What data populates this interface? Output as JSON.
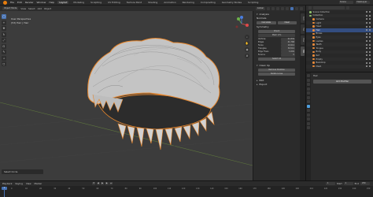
{
  "app": {
    "menus": [
      "File",
      "Edit",
      "Render",
      "Window",
      "Help"
    ],
    "workspaces": [
      "Layout",
      "Modeling",
      "Sculpting",
      "UV Editing",
      "Texture Paint",
      "Shading",
      "Animation",
      "Rendering",
      "Compositing",
      "Geometry Nodes",
      "Scripting"
    ],
    "active_workspace": "Layout",
    "scene_label": "Scene",
    "view_layer_label": "ViewLayer"
  },
  "viewport": {
    "mode_label": "Object Mode",
    "header_menus": [
      "View",
      "Select",
      "Add",
      "Object"
    ],
    "transform_label": "Global",
    "info_line1": "User Perspective",
    "info_line2": "(53) Hair | Hair",
    "operator_panel_label": "Select Circle"
  },
  "npanel": {
    "analysis_header": "Analysis",
    "normals_header": "Normals",
    "normals_btn1": "Calculate",
    "normals_btn2": "Clear",
    "symmetry_header": "Symmetry",
    "symmetry_btn": "Check",
    "symmetry_sub": "Mesh Info",
    "stats": [
      {
        "label": "Vertices",
        "value": "21,834"
      },
      {
        "label": "Edges",
        "value": "41,768"
      },
      {
        "label": "Faces",
        "value": "19,914"
      },
      {
        "label": "Triangles",
        "value": "39,512"
      },
      {
        "label": "Edge Flows",
        "value": "1,602"
      },
      {
        "label": "N-Gons",
        "value": "0"
      }
    ],
    "fill_btn": "Select All",
    "clean_header": "Clean Up",
    "clean_btn1": "Remove Doubles",
    "clean_btn2": "Delete Loose",
    "edit_header": "Edit",
    "export_header": "Export",
    "tabs": [
      "Item",
      "Tool",
      "View",
      "Edit"
    ]
  },
  "outliner": {
    "rows": [
      {
        "label": "Scene Collection",
        "selected": false,
        "type": "g"
      },
      {
        "label": "Collection",
        "selected": false,
        "type": "g"
      },
      {
        "label": "Camera",
        "selected": false,
        "type": "o"
      },
      {
        "label": "Light",
        "selected": false,
        "type": "o"
      },
      {
        "label": "Head",
        "selected": false,
        "type": "o"
      },
      {
        "label": "Hair",
        "selected": true,
        "type": "o"
      },
      {
        "label": "Brows",
        "selected": false,
        "type": "o"
      },
      {
        "label": "Eyes",
        "selected": false,
        "type": "o"
      },
      {
        "label": "Lashes",
        "selected": false,
        "type": "o"
      },
      {
        "label": "Teeth",
        "selected": false,
        "type": "o"
      },
      {
        "label": "Tongue",
        "selected": false,
        "type": "o"
      },
      {
        "label": "Body",
        "selected": false,
        "type": "o"
      },
      {
        "label": "Ref",
        "selected": false,
        "type": "o"
      },
      {
        "label": "Empty",
        "selected": false,
        "type": "o"
      },
      {
        "label": "Backdrop",
        "selected": false,
        "type": "o"
      },
      {
        "label": "Mesh",
        "selected": false,
        "type": "o"
      }
    ]
  },
  "properties": {
    "object_name": "Hair",
    "add_modifier_label": "Add Modifier"
  },
  "timeline": {
    "menus": [
      "Playback",
      "Keying",
      "View",
      "Marker"
    ],
    "current_frame": "1",
    "start_label": "Start",
    "start_value": "1",
    "end_label": "End",
    "end_value": "250",
    "ticks": [
      "0",
      "10",
      "20",
      "30",
      "40",
      "50",
      "60",
      "70",
      "80",
      "90",
      "100",
      "110",
      "120",
      "130",
      "140",
      "150",
      "160",
      "170",
      "180",
      "190",
      "200",
      "210",
      "220",
      "230",
      "240",
      "250"
    ]
  },
  "status": {
    "text": "Select"
  },
  "colors": {
    "accent": "#4772b3",
    "selection_outline": "#e8862b",
    "viewport_bg": "#3c3c3c",
    "hair_surface": "#c9c9c9"
  }
}
